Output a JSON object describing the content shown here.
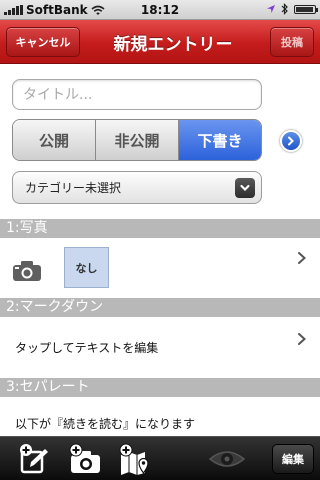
{
  "status_bar": {
    "carrier": "SoftBank",
    "time": "18:12",
    "battery_level": 0.95
  },
  "nav": {
    "cancel_label": "キャンセル",
    "title": "新規エントリー",
    "post_label": "投稿"
  },
  "form": {
    "title_placeholder": "タイトル...",
    "title_value": "",
    "visibility_options": [
      "公開",
      "非公開",
      "下書き"
    ],
    "visibility_selected": "下書き",
    "category_value": "カテゴリー未選択"
  },
  "sections": {
    "photo": {
      "header": "1:写真",
      "thumbnail_label": "なし"
    },
    "markdown": {
      "header": "2:マークダウン",
      "text": "タップしてテキストを編集"
    },
    "separator": {
      "header": "3:セパレート",
      "text": "以下が『続きを読む』になります"
    }
  },
  "toolbar": {
    "icons": [
      "add-text-icon",
      "add-photo-icon",
      "add-map-icon",
      "preview-eye-icon"
    ],
    "edit_label": "編集"
  },
  "colors": {
    "nav_red": "#c51c1c",
    "selected_blue": "#2c62db",
    "section_gray": "#b8b8b8"
  }
}
